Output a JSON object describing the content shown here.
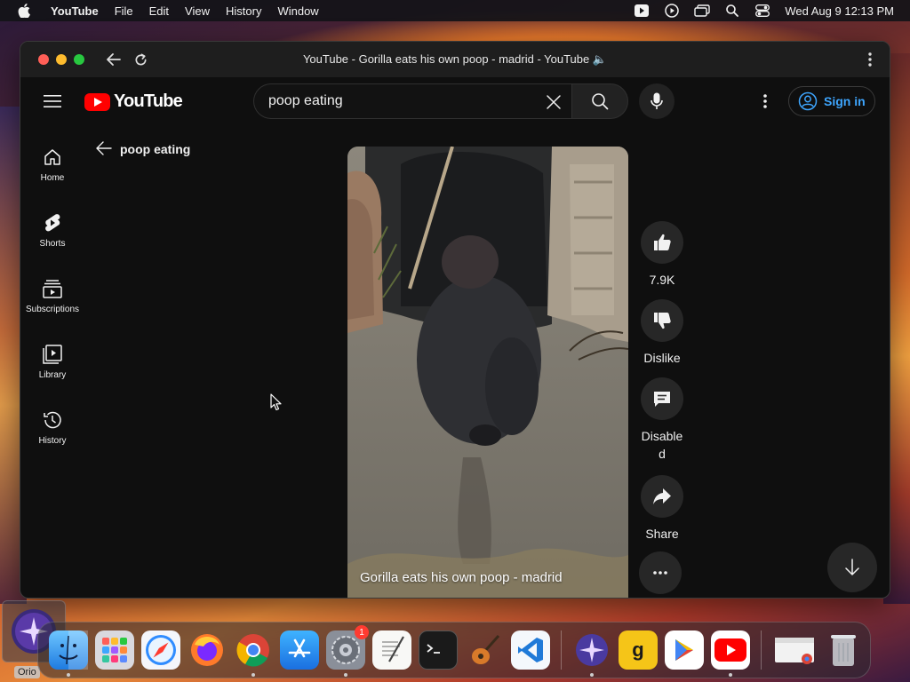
{
  "menubar": {
    "app_name": "YouTube",
    "items": [
      "File",
      "Edit",
      "View",
      "History",
      "Window"
    ],
    "clock": "Wed Aug 9  12:13 PM"
  },
  "window": {
    "title": "YouTube - Gorilla eats his own poop - madrid - YouTube 🔈"
  },
  "header": {
    "logo_text": "YouTube",
    "search_value": "poop eating",
    "signin_label": "Sign in"
  },
  "sidebar": {
    "items": [
      {
        "label": "Home",
        "icon": "home-icon"
      },
      {
        "label": "Shorts",
        "icon": "shorts-icon"
      },
      {
        "label": "Subscriptions",
        "icon": "subscriptions-icon"
      },
      {
        "label": "Library",
        "icon": "library-icon"
      },
      {
        "label": "History",
        "icon": "history-icon"
      }
    ]
  },
  "shorts": {
    "query": "poop eating",
    "video_caption": "Gorilla eats his own poop - madrid"
  },
  "actions": {
    "like_count": "7.9K",
    "dislike_label": "Dislike",
    "comments_label": "Disable\nd",
    "share_label": "Share"
  },
  "dock": {
    "apps": [
      "finder",
      "launchpad",
      "safari",
      "firefox",
      "chrome",
      "app-store",
      "system-settings",
      "textedit",
      "terminal",
      "garageband",
      "vscode",
      "orion",
      "grammarly",
      "google-play",
      "youtube",
      "chrome-window",
      "trash"
    ],
    "system_settings_badge": "1",
    "orion_label": "Orio"
  },
  "colors": {
    "accent_blue": "#3ea6ff",
    "youtube_red": "#ff0000",
    "background": "#0f0f0f"
  }
}
